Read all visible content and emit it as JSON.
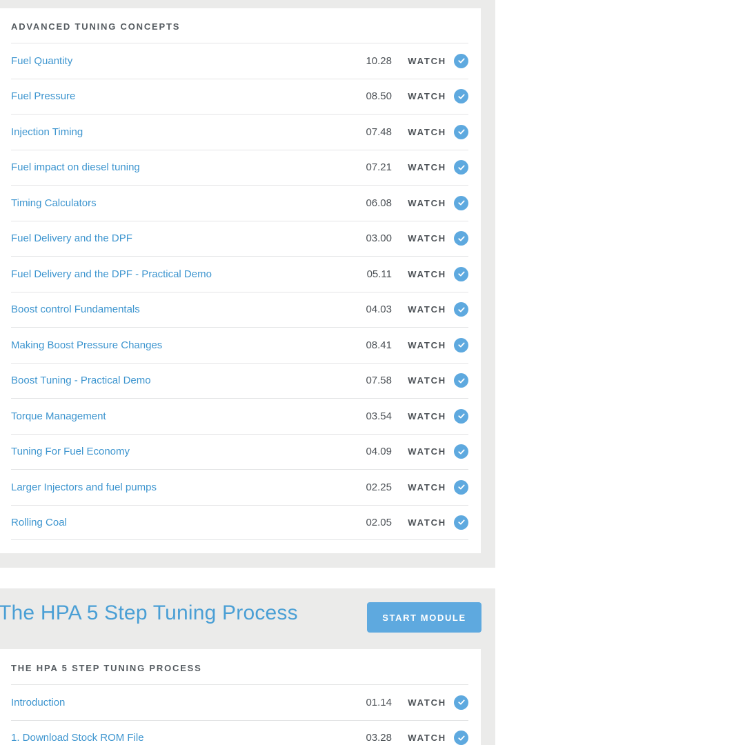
{
  "module_advanced": {
    "section_title": "ADVANCED TUNING CONCEPTS",
    "lessons": [
      {
        "title": "Fuel Quantity",
        "duration": "10.28",
        "action": "WATCH",
        "completed": true
      },
      {
        "title": "Fuel Pressure",
        "duration": "08.50",
        "action": "WATCH",
        "completed": true
      },
      {
        "title": "Injection Timing",
        "duration": "07.48",
        "action": "WATCH",
        "completed": true
      },
      {
        "title": "Fuel impact on diesel tuning",
        "duration": "07.21",
        "action": "WATCH",
        "completed": true
      },
      {
        "title": "Timing Calculators",
        "duration": "06.08",
        "action": "WATCH",
        "completed": true
      },
      {
        "title": "Fuel Delivery and the DPF",
        "duration": "03.00",
        "action": "WATCH",
        "completed": true
      },
      {
        "title": "Fuel Delivery and the DPF - Practical Demo",
        "duration": "05.11",
        "action": "WATCH",
        "completed": true
      },
      {
        "title": "Boost control Fundamentals",
        "duration": "04.03",
        "action": "WATCH",
        "completed": true
      },
      {
        "title": "Making Boost Pressure Changes",
        "duration": "08.41",
        "action": "WATCH",
        "completed": true
      },
      {
        "title": "Boost Tuning - Practical Demo",
        "duration": "07.58",
        "action": "WATCH",
        "completed": true
      },
      {
        "title": "Torque Management",
        "duration": "03.54",
        "action": "WATCH",
        "completed": true
      },
      {
        "title": "Tuning For Fuel Economy",
        "duration": "04.09",
        "action": "WATCH",
        "completed": true
      },
      {
        "title": "Larger Injectors and fuel pumps",
        "duration": "02.25",
        "action": "WATCH",
        "completed": true
      },
      {
        "title": "Rolling Coal",
        "duration": "02.05",
        "action": "WATCH",
        "completed": true
      }
    ]
  },
  "module_hpa": {
    "title": "The HPA 5 Step Tuning Process",
    "start_button": "START MODULE",
    "section_title": "THE HPA 5 STEP TUNING PROCESS",
    "lessons": [
      {
        "title": "Introduction",
        "duration": "01.14",
        "action": "WATCH",
        "completed": true
      },
      {
        "title": "1. Download Stock ROM File",
        "duration": "03.28",
        "action": "WATCH",
        "completed": true
      }
    ]
  },
  "colors": {
    "accent": "#5ea9df",
    "link": "#3d95cf",
    "module_background": "#ebebea",
    "text_dark": "#4d5257"
  },
  "icons": {
    "completed": "check-circle-icon"
  }
}
